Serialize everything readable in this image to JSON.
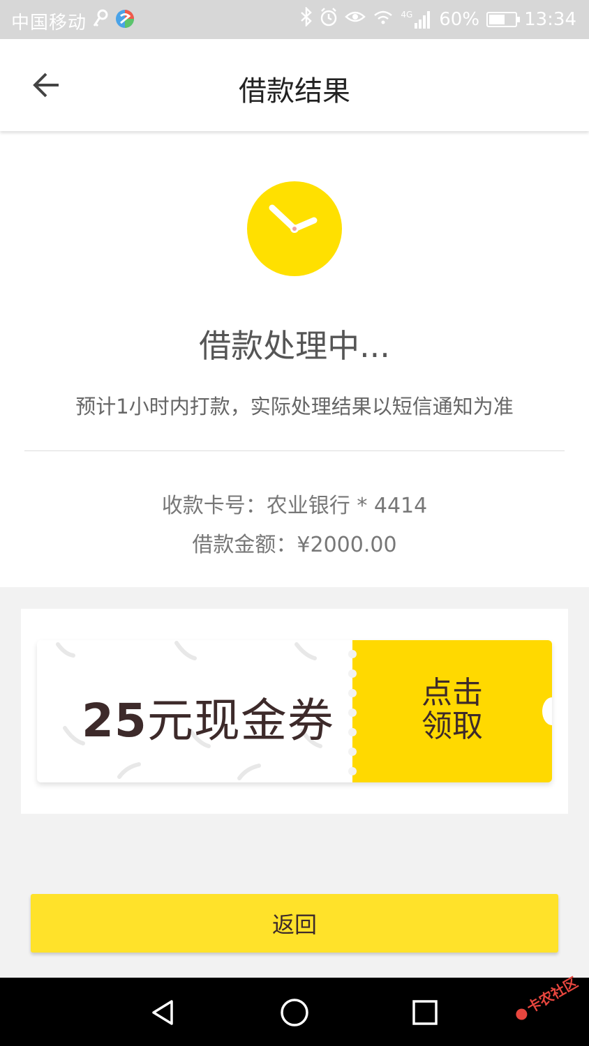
{
  "status_bar": {
    "carrier": "中国移动",
    "network": "4G",
    "battery": "60%",
    "battery_level": 0.6,
    "time": "13:34"
  },
  "header": {
    "title": "借款结果",
    "back_icon": "arrow-left-icon"
  },
  "result": {
    "icon": "clock-icon",
    "accent_color": "#ffe000",
    "title": "借款处理中...",
    "subtitle": "预计1小时内打款，实际处理结果以短信通知为准",
    "card_label": "收款卡号：",
    "card_value": "农业银行 * 4414",
    "amount_label": "借款金额：",
    "amount_value": "¥2000.00"
  },
  "coupon": {
    "amount": "25",
    "unit_text": "元现金券",
    "claim_line1": "点击",
    "claim_line2": "领取",
    "claim_color": "#ffd900"
  },
  "return_button": {
    "label": "返回",
    "color": "#ffe22a"
  },
  "nav_bar": {
    "back": "triangle-back-icon",
    "home": "circle-home-icon",
    "recent": "square-recent-icon"
  },
  "watermark": {
    "text": "卡农社区"
  }
}
